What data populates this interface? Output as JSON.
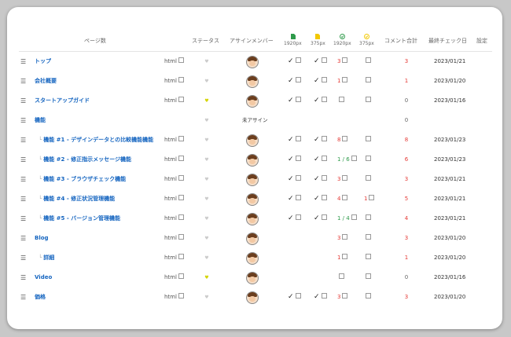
{
  "header": {
    "page_col": "ページ数",
    "status_col": "ステータス",
    "assign_col": "アサインメンバー",
    "pc_design": "1920px",
    "sp_design": "375px",
    "pc_check": "1920px",
    "sp_check": "375px",
    "comment_total": "コメント合計",
    "last_check": "最終チェック日",
    "settings": "設定"
  },
  "colors": {
    "link": "#1565c0",
    "count_red": "#e53935",
    "count_green": "#2e9a4a",
    "status_on": "#d4d400",
    "pc_icon": "#2e9a4a",
    "sp_icon": "#f2c800"
  },
  "icons": {
    "drag": "drag-handle-icon",
    "ext": "external-link-icon",
    "status": "heart-icon",
    "check": "check-icon",
    "avatar": "avatar-icon"
  },
  "labels": {
    "html": "html",
    "check": "✓",
    "unassigned": "未アサイン",
    "drag": "☰",
    "status": "♥",
    "tree": "└"
  },
  "rows": [
    {
      "name": "トップ",
      "child": false,
      "html": "html",
      "status": "off",
      "assign": "avatar",
      "pc": "✓",
      "sp": "✓",
      "pcc": "3",
      "pcc_color": "red",
      "spc": "",
      "comments": "3",
      "date": "2023/01/21"
    },
    {
      "name": "会社概要",
      "child": false,
      "html": "html",
      "status": "off",
      "assign": "avatar",
      "pc": "✓",
      "sp": "✓",
      "pcc": "1",
      "pcc_color": "red",
      "spc": "",
      "comments": "1",
      "date": "2023/01/20"
    },
    {
      "name": "スタートアップガイド",
      "child": false,
      "html": "html",
      "status": "on",
      "assign": "avatar",
      "pc": "✓",
      "sp": "✓",
      "pcc": "",
      "pcc_color": "",
      "spc": "",
      "comments": "0",
      "date": "2023/01/16"
    },
    {
      "name": "機能",
      "child": false,
      "html": "",
      "status": "off",
      "assign": "unassigned",
      "pc": "",
      "sp": "",
      "pcc": "",
      "pcc_color": "",
      "spc": "",
      "comments": "0",
      "date": ""
    },
    {
      "name": "機能 #1 - デザインデータとの比較機能機能",
      "child": true,
      "html": "html",
      "status": "off",
      "assign": "avatar",
      "pc": "✓",
      "sp": "✓",
      "pcc": "8",
      "pcc_color": "red",
      "spc": "",
      "comments": "8",
      "date": "2023/01/23"
    },
    {
      "name": "機能 #2 - 修正指示メッセージ機能",
      "child": true,
      "html": "html",
      "status": "off",
      "assign": "avatar",
      "pc": "✓",
      "sp": "✓",
      "pcc": "1 / 6",
      "pcc_color": "green",
      "spc": "",
      "comments": "6",
      "date": "2023/01/23"
    },
    {
      "name": "機能 #3 - ブラウザチェック機能",
      "child": true,
      "html": "html",
      "status": "off",
      "assign": "avatar",
      "pc": "✓",
      "sp": "✓",
      "pcc": "3",
      "pcc_color": "red",
      "spc": "",
      "comments": "3",
      "date": "2023/01/21"
    },
    {
      "name": "機能 #4 - 修正状況管理機能",
      "child": true,
      "html": "html",
      "status": "off",
      "assign": "avatar",
      "pc": "✓",
      "sp": "✓",
      "pcc": "4",
      "pcc_color": "red",
      "spc": "1",
      "comments": "5",
      "date": "2023/01/21"
    },
    {
      "name": "機能 #5 - バージョン管理機能",
      "child": true,
      "html": "html",
      "status": "off",
      "assign": "avatar",
      "pc": "✓",
      "sp": "✓",
      "pcc": "1 / 4",
      "pcc_color": "green",
      "spc": "",
      "comments": "4",
      "date": "2023/01/21"
    },
    {
      "name": "Blog",
      "child": false,
      "html": "html",
      "status": "off",
      "assign": "avatar",
      "pc": "",
      "sp": "",
      "pcc": "3",
      "pcc_color": "red",
      "spc": "",
      "comments": "3",
      "date": "2023/01/20"
    },
    {
      "name": "詳細",
      "child": true,
      "html": "html",
      "status": "off",
      "assign": "avatar",
      "pc": "",
      "sp": "",
      "pcc": "1",
      "pcc_color": "red",
      "spc": "",
      "comments": "1",
      "date": "2023/01/20"
    },
    {
      "name": "Video",
      "child": false,
      "html": "html",
      "status": "on",
      "assign": "avatar",
      "pc": "",
      "sp": "",
      "pcc": "",
      "pcc_color": "",
      "spc": "",
      "comments": "0",
      "date": "2023/01/16"
    },
    {
      "name": "価格",
      "child": false,
      "html": "html",
      "status": "off",
      "assign": "avatar",
      "pc": "✓",
      "sp": "✓",
      "pcc": "3",
      "pcc_color": "red",
      "spc": "",
      "comments": "3",
      "date": "2023/01/20"
    }
  ]
}
